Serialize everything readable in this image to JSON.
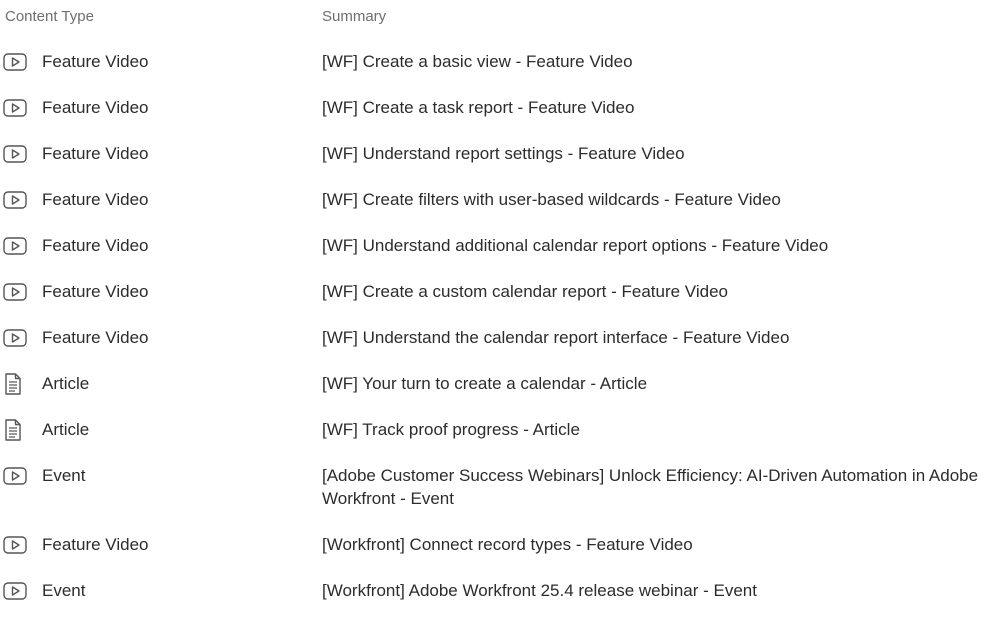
{
  "header": {
    "content_type": "Content Type",
    "summary": "Summary"
  },
  "rows": [
    {
      "type": "Feature Video",
      "icon": "play-icon",
      "summary": "[WF] Create a basic view - Feature Video"
    },
    {
      "type": "Feature Video",
      "icon": "play-icon",
      "summary": "[WF] Create a task report - Feature Video"
    },
    {
      "type": "Feature Video",
      "icon": "play-icon",
      "summary": "[WF] Understand report settings - Feature Video"
    },
    {
      "type": "Feature Video",
      "icon": "play-icon",
      "summary": "[WF] Create filters with user-based wildcards - Feature Video"
    },
    {
      "type": "Feature Video",
      "icon": "play-icon",
      "summary": "[WF] Understand additional calendar report options - Feature Video"
    },
    {
      "type": "Feature Video",
      "icon": "play-icon",
      "summary": "[WF] Create a custom calendar report - Feature Video"
    },
    {
      "type": "Feature Video",
      "icon": "play-icon",
      "summary": "[WF] Understand the calendar report interface - Feature Video"
    },
    {
      "type": "Article",
      "icon": "document-icon",
      "summary": "[WF] Your turn to create a calendar - Article"
    },
    {
      "type": "Article",
      "icon": "document-icon",
      "summary": "[WF] Track proof progress - Article"
    },
    {
      "type": "Event",
      "icon": "play-icon",
      "summary": "[Adobe Customer Success Webinars] Unlock Efficiency: AI-Driven Automation in Adobe Workfront - Event"
    },
    {
      "type": "Feature Video",
      "icon": "play-icon",
      "summary": "[Workfront] Connect record types - Feature Video"
    },
    {
      "type": "Event",
      "icon": "play-icon",
      "summary": "[Workfront] Adobe Workfront 25.4 release webinar - Event"
    }
  ],
  "colors": {
    "header_text": "#6e6e6e",
    "body_text": "#2c2c2c",
    "icon_stroke": "#555555"
  }
}
